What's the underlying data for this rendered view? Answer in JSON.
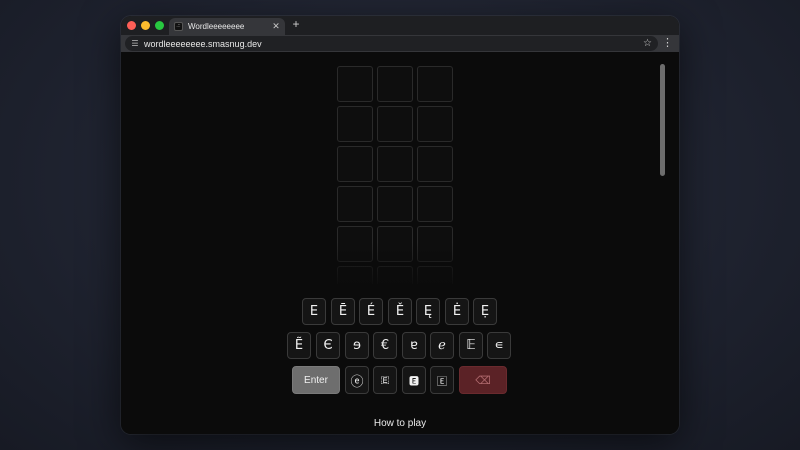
{
  "browser": {
    "tab_title": "Wordleeeeeeee",
    "favicon_glyph": ".::",
    "url": "wordleeeeeeee.smasnug.dev",
    "new_tab_icon": "plus-icon",
    "menu_icon": "kebab-menu-icon"
  },
  "game": {
    "grid": {
      "rows_visible": 6,
      "columns": 3
    },
    "keyboard": {
      "row1": [
        "E",
        "Ē",
        "É",
        "Ě",
        "Ę",
        "Ė",
        "Ẹ"
      ],
      "row2": [
        "Ẽ",
        "Є",
        "ɘ",
        "€",
        "ɐ",
        "ℯ",
        "𝔼",
        "∊"
      ],
      "row3": {
        "enter_label": "Enter",
        "keys": [
          "ⓔ",
          "🇪",
          "🅴",
          "🄴"
        ],
        "backspace_icon": "⌫"
      }
    },
    "how_to_play_label": "How to play"
  },
  "colors": {
    "enter_key": "#6e6e6e",
    "backspace_key": "#5b2226",
    "tile_border": "#2a2a2a"
  }
}
